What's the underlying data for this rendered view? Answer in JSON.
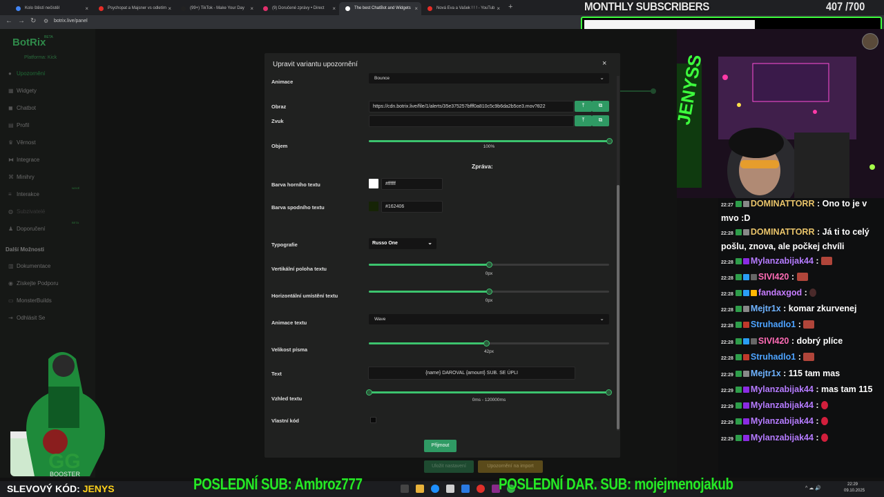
{
  "browser": {
    "tabs": [
      {
        "label": "Kolo štěstí nečistěl",
        "color": "#4285f4",
        "active": false
      },
      {
        "label": "Psychopat a Majsner vs odletím",
        "color": "#e52d27",
        "active": false
      },
      {
        "label": "(99+) TikTok - Make Your Day",
        "color": "#222222",
        "active": false
      },
      {
        "label": "(9) Doručené zprávy • Direct",
        "color": "#e1306c",
        "active": false
      },
      {
        "label": "The best ChatBot and Widgets",
        "color": "#ffffff",
        "active": true
      },
      {
        "label": "Nová Eva a Vašek ! ! ! - YouTub",
        "color": "#e52d27",
        "active": false
      }
    ],
    "new_tab": "+",
    "url": "botrix.live/panel"
  },
  "overlay": {
    "subs_title": "MONTHLY SUBSCRIBERS",
    "subs_count": "407 /700",
    "subs_progress": 0.58,
    "ticker_sub": "POSLEDNÍ SUB: Ambroz777",
    "ticker_gift": "POSLEDNÍ DAR. SUB: mojejmenojakub",
    "promo_label": "SLEVOVÝ KÓD: ",
    "promo_code": "JENYS"
  },
  "sidebar": {
    "brand": "BotRix",
    "brand_badge": "BETA",
    "platform": "Platforma: Kick",
    "items": [
      {
        "label": "Upozornění",
        "icon": "dot-icon"
      },
      {
        "label": "Widgety",
        "icon": "grid-icon"
      },
      {
        "label": "Chatbot",
        "icon": "chat-icon"
      },
      {
        "label": "Profil",
        "icon": "file-icon"
      },
      {
        "label": "Věrnost",
        "icon": "trophy-icon"
      },
      {
        "label": "Integrace",
        "icon": "link-icon"
      },
      {
        "label": "Minihry",
        "icon": "gamepad-icon"
      },
      {
        "label": "Interakce",
        "icon": "sliders-icon",
        "badge": "NOVÉ"
      },
      {
        "label": "Subzivatelé",
        "icon": "users-icon"
      },
      {
        "label": "Doporučení",
        "icon": "user-plus-icon",
        "badge": "BETA"
      }
    ],
    "other_title": "Další Možnosti",
    "other_items": [
      {
        "label": "Dokumentace",
        "icon": "book-icon"
      },
      {
        "label": "Získejte Podporu",
        "icon": "help-icon"
      },
      {
        "label": "MonsterBuilds",
        "icon": "monitor-icon"
      },
      {
        "label": "Odhlásit Se",
        "icon": "logout-icon"
      }
    ]
  },
  "background_buttons": {
    "save": "Uložit nastavení",
    "import": "Upozornění na import"
  },
  "modal": {
    "title": "Upravit variantu upozornění",
    "close": "×",
    "fields": {
      "animation_label": "Animace",
      "animation_value": "Bounce",
      "image_label": "Obraz",
      "image_value": "https://cdn.botrix.live/file/1/alerts/35e375257bfff0a810c5c9b6da2b5ce3.mov?822",
      "sound_label": "Zvuk",
      "sound_value": "",
      "volume_label": "Objem",
      "volume_value": "100%",
      "volume_fraction": 1.0,
      "message_heading": "Zpráva:",
      "top_color_label": "Barva horního textu",
      "top_color_value": "#ffffff",
      "bottom_color_label": "Barva spodního textu",
      "bottom_color_value": "#162406",
      "font_label": "Typografie",
      "font_value": "Russo One",
      "vpos_label": "Vertikální poloha textu",
      "vpos_value": "0px",
      "vpos_fraction": 0.5,
      "hpos_label": "Horizontální umístění textu",
      "hpos_value": "0px",
      "hpos_fraction": 0.5,
      "text_anim_label": "Animace textu",
      "text_anim_value": "Wave",
      "font_size_label": "Velikost písma",
      "font_size_value": "42px",
      "font_size_fraction": 0.49,
      "text_label": "Text",
      "text_value": "{name} DAROVAL {amount} SUB. SE ÚPLI",
      "appearance_label": "Vzhled textu",
      "appearance_value": "0ms - 120000ms",
      "custom_code_label": "Vlastní kód",
      "custom_code_checked": false
    },
    "accept_button": "Přijmout"
  },
  "chat": [
    {
      "time": "22:27",
      "user": "DOMINATTORR",
      "color": "#e9c46a",
      "text": ": Ono to je v mvo :D",
      "badges": [
        "#2e9d4a",
        "#888888"
      ]
    },
    {
      "time": "22:28",
      "user": "DOMINATTORR",
      "color": "#e9c46a",
      "text": ": Já ti to celý pošlu, znova, ale počkej chvíli",
      "badges": [
        "#2e9d4a",
        "#888888"
      ]
    },
    {
      "time": "22:28",
      "user": "Mylanzabijak44",
      "color": "#b57bff",
      "text": ":",
      "badges": [
        "#2e9d4a",
        "#8a2be2"
      ],
      "emote": "box"
    },
    {
      "time": "22:28",
      "user": "SIVI420",
      "color": "#ff6bb5",
      "text": ":",
      "badges": [
        "#2e9d4a",
        "#2a9df4",
        "#666666"
      ],
      "emote": "box"
    },
    {
      "time": "22:28",
      "user": "fandaxgod",
      "color": "#c77dff",
      "text": ":",
      "badges": [
        "#2e9d4a",
        "#2a9df4",
        "#ffb703"
      ],
      "emote": "dark"
    },
    {
      "time": "22:28",
      "user": "Mejtr1x",
      "color": "#6fb3ff",
      "text": ": komar zkurvenej",
      "badges": [
        "#2e9d4a",
        "#888888"
      ]
    },
    {
      "time": "22:28",
      "user": "Struhadlo1",
      "color": "#4da3ff",
      "text": ":",
      "badges": [
        "#2e9d4a",
        "#c0392b"
      ],
      "emote": "box"
    },
    {
      "time": "22:28",
      "user": "SIVI420",
      "color": "#ff6bb5",
      "text": ": dobrý plíce",
      "badges": [
        "#2e9d4a",
        "#2a9df4",
        "#666666"
      ]
    },
    {
      "time": "22:28",
      "user": "Struhadlo1",
      "color": "#4da3ff",
      "text": ":",
      "badges": [
        "#2e9d4a",
        "#c0392b"
      ],
      "emote": "box"
    },
    {
      "time": "22:29",
      "user": "Mejtr1x",
      "color": "#6fb3ff",
      "text": ": 115 tam mas",
      "badges": [
        "#2e9d4a",
        "#888888"
      ]
    },
    {
      "time": "22:29",
      "user": "Mylanzabijak44",
      "color": "#b57bff",
      "text": ": mas tam 115",
      "badges": [
        "#2e9d4a",
        "#8a2be2"
      ]
    },
    {
      "time": "22:29",
      "user": "Mylanzabijak44",
      "color": "#b57bff",
      "text": ":",
      "badges": [
        "#2e9d4a",
        "#8a2be2"
      ],
      "emote": "red"
    },
    {
      "time": "22:29",
      "user": "Mylanzabijak44",
      "color": "#b57bff",
      "text": ":",
      "badges": [
        "#2e9d4a",
        "#8a2be2"
      ],
      "emote": "red"
    },
    {
      "time": "22:29",
      "user": "Mylanzabijak44",
      "color": "#b57bff",
      "text": ":",
      "badges": [
        "#2e9d4a",
        "#8a2be2"
      ],
      "emote": "red"
    }
  ],
  "taskbar": {
    "time": "22:29",
    "date": "09.10.2025",
    "tray": "^ ☁ 🔊"
  },
  "colors": {
    "accent": "#2f9a64",
    "overlay_green": "#26e826",
    "promo_yellow": "#ffd21a"
  }
}
